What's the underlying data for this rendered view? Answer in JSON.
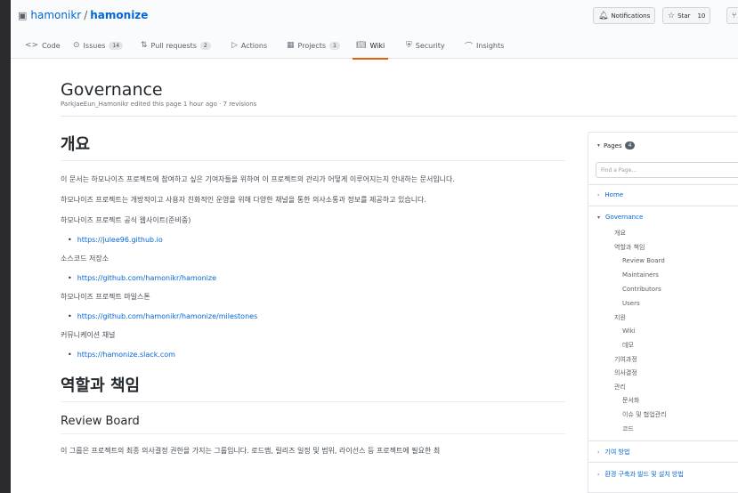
{
  "header": {
    "owner": "hamonikr",
    "separator": "/",
    "repo": "hamonize",
    "buttons": {
      "notifications": "Notifications",
      "star": "Star",
      "star_count": "10"
    }
  },
  "tabs": [
    {
      "label": "Code",
      "count": ""
    },
    {
      "label": "Issues",
      "count": "14"
    },
    {
      "label": "Pull requests",
      "count": "2"
    },
    {
      "label": "Actions",
      "count": ""
    },
    {
      "label": "Projects",
      "count": "1"
    },
    {
      "label": "Wiki",
      "count": ""
    },
    {
      "label": "Security",
      "count": ""
    },
    {
      "label": "Insights",
      "count": ""
    }
  ],
  "page": {
    "title": "Governance",
    "meta": "ParkJaeEun_Hamonikr edited this page 1 hour ago · 7 revisions"
  },
  "content": {
    "overview_heading": "개요",
    "intro": "이 문서는 하모나이즈 프로젝트에 참여하고 싶은 기여자들을 위하여 이 프로젝트의 관리가 어떻게 이루어지는지 안내하는 문서입니다.",
    "intro2": "하모나이즈 프로젝트는 개방적이고 사용자 친화적인 운영을 위해 다양한 채널을 통한 의사소통과 정보를 제공하고 있습니다.",
    "website_label": "하모나이즈 프로젝트 공식 웹사이트(준비중)",
    "website_link": "https://julee96.github.io",
    "source_label": "소스코드 저장소",
    "source_link": "https://github.com/hamonikr/hamonize",
    "milestone_label": "하모나이즈 프로젝트 마일스톤",
    "milestone_link": "https://github.com/hamonikr/hamonize/milestones",
    "community_label": "커뮤니케이션 채널",
    "community_link": "https://hamonize.slack.com",
    "roles_heading": "역할과 책임",
    "review_heading": "Review Board",
    "review_text": "이 그룹은 프로젝트의 최종 의사결정 권한을 가지는 그룹입니다. 로드맵, 릴리즈 일정 및 범위, 라이선스 등 프로젝트에 필요한 최"
  },
  "sidebar": {
    "pages_label": "Pages",
    "pages_count": "4",
    "find_placeholder": "Find a Page...",
    "home": "Home",
    "governance": "Governance",
    "sub": [
      "개요",
      "역할과 책임",
      "Review Board",
      "Maintainers",
      "Contributors",
      "Users",
      "지원",
      "Wiki",
      "데모",
      "기여과정",
      "의사결정",
      "관리",
      "문서화",
      "이슈 및 협업관리",
      "코드"
    ],
    "contrib": "기여 방법",
    "build": "환경 구축과 빌드 및 설치 방법"
  }
}
